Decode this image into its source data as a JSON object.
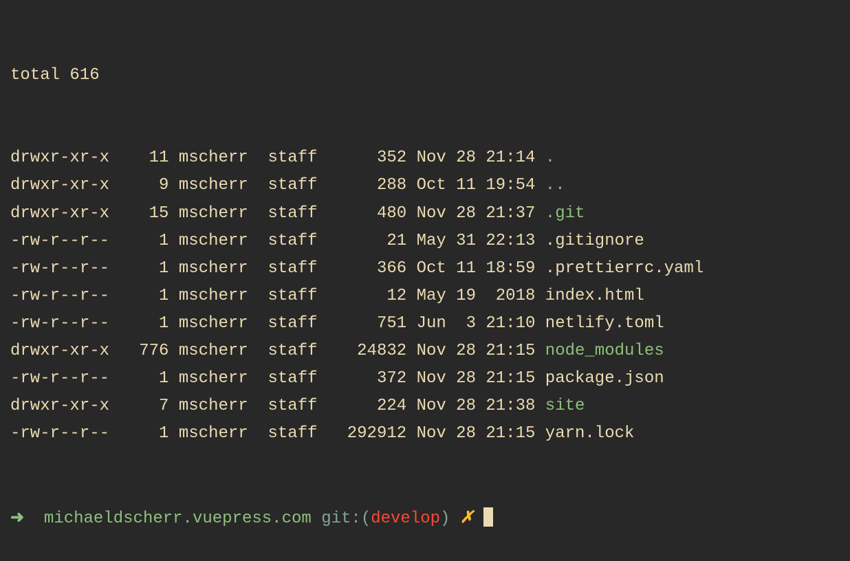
{
  "total_line": "total 616",
  "rows": [
    {
      "perms": "drwxr-xr-x",
      "links": "11",
      "owner": "mscherr",
      "group": "staff",
      "size": "352",
      "date": "Nov 28 21:14",
      "name": ".",
      "is_dir": true
    },
    {
      "perms": "drwxr-xr-x",
      "links": "9",
      "owner": "mscherr",
      "group": "staff",
      "size": "288",
      "date": "Oct 11 19:54",
      "name": "..",
      "is_dir": true
    },
    {
      "perms": "drwxr-xr-x",
      "links": "15",
      "owner": "mscherr",
      "group": "staff",
      "size": "480",
      "date": "Nov 28 21:37",
      "name": ".git",
      "is_dir": true
    },
    {
      "perms": "-rw-r--r--",
      "links": "1",
      "owner": "mscherr",
      "group": "staff",
      "size": "21",
      "date": "May 31 22:13",
      "name": ".gitignore",
      "is_dir": false
    },
    {
      "perms": "-rw-r--r--",
      "links": "1",
      "owner": "mscherr",
      "group": "staff",
      "size": "366",
      "date": "Oct 11 18:59",
      "name": ".prettierrc.yaml",
      "is_dir": false
    },
    {
      "perms": "-rw-r--r--",
      "links": "1",
      "owner": "mscherr",
      "group": "staff",
      "size": "12",
      "date": "May 19  2018",
      "name": "index.html",
      "is_dir": false
    },
    {
      "perms": "-rw-r--r--",
      "links": "1",
      "owner": "mscherr",
      "group": "staff",
      "size": "751",
      "date": "Jun  3 21:10",
      "name": "netlify.toml",
      "is_dir": false
    },
    {
      "perms": "drwxr-xr-x",
      "links": "776",
      "owner": "mscherr",
      "group": "staff",
      "size": "24832",
      "date": "Nov 28 21:15",
      "name": "node_modules",
      "is_dir": true
    },
    {
      "perms": "-rw-r--r--",
      "links": "1",
      "owner": "mscherr",
      "group": "staff",
      "size": "372",
      "date": "Nov 28 21:15",
      "name": "package.json",
      "is_dir": false
    },
    {
      "perms": "drwxr-xr-x",
      "links": "7",
      "owner": "mscherr",
      "group": "staff",
      "size": "224",
      "date": "Nov 28 21:38",
      "name": "site",
      "is_dir": true
    },
    {
      "perms": "-rw-r--r--",
      "links": "1",
      "owner": "mscherr",
      "group": "staff",
      "size": "292912",
      "date": "Nov 28 21:15",
      "name": "yarn.lock",
      "is_dir": false
    }
  ],
  "prompt": {
    "arrow": "➜",
    "cwd": "michaeldscherr.vuepress.com",
    "git_label_pre": "git:(",
    "git_branch": "develop",
    "git_label_post": ")",
    "dirty": "✗"
  }
}
